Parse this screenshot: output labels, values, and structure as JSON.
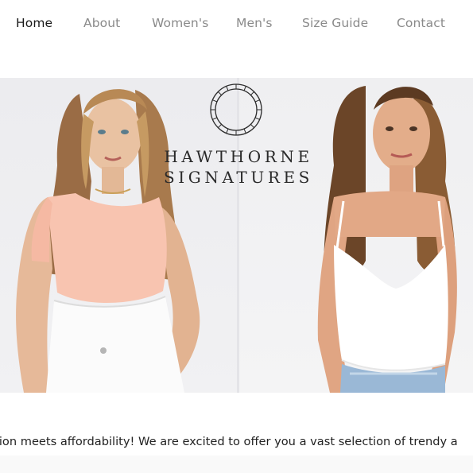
{
  "nav": {
    "items": [
      {
        "label": "Home",
        "active": true
      },
      {
        "label": "About",
        "active": false
      },
      {
        "label": "Women's",
        "active": false
      },
      {
        "label": "Men's",
        "active": false
      },
      {
        "label": "Size Guide",
        "active": false
      },
      {
        "label": "Contact",
        "active": false
      }
    ]
  },
  "hero": {
    "brand_line_1": "HAWTHORNE",
    "brand_line_2": "SIGNATURES",
    "logo_icon": "circular-window-emblem",
    "left_model_top_color": "#f8c4b0",
    "right_model_top_color": "#ffffff"
  },
  "marquee": {
    "text": "shion meets affordability! We are excited to offer you a vast selection of trendy a"
  },
  "colors": {
    "nav_active": "#1a1a1a",
    "nav_inactive": "#8a8a8a",
    "hero_bg": "#eeeef1"
  }
}
